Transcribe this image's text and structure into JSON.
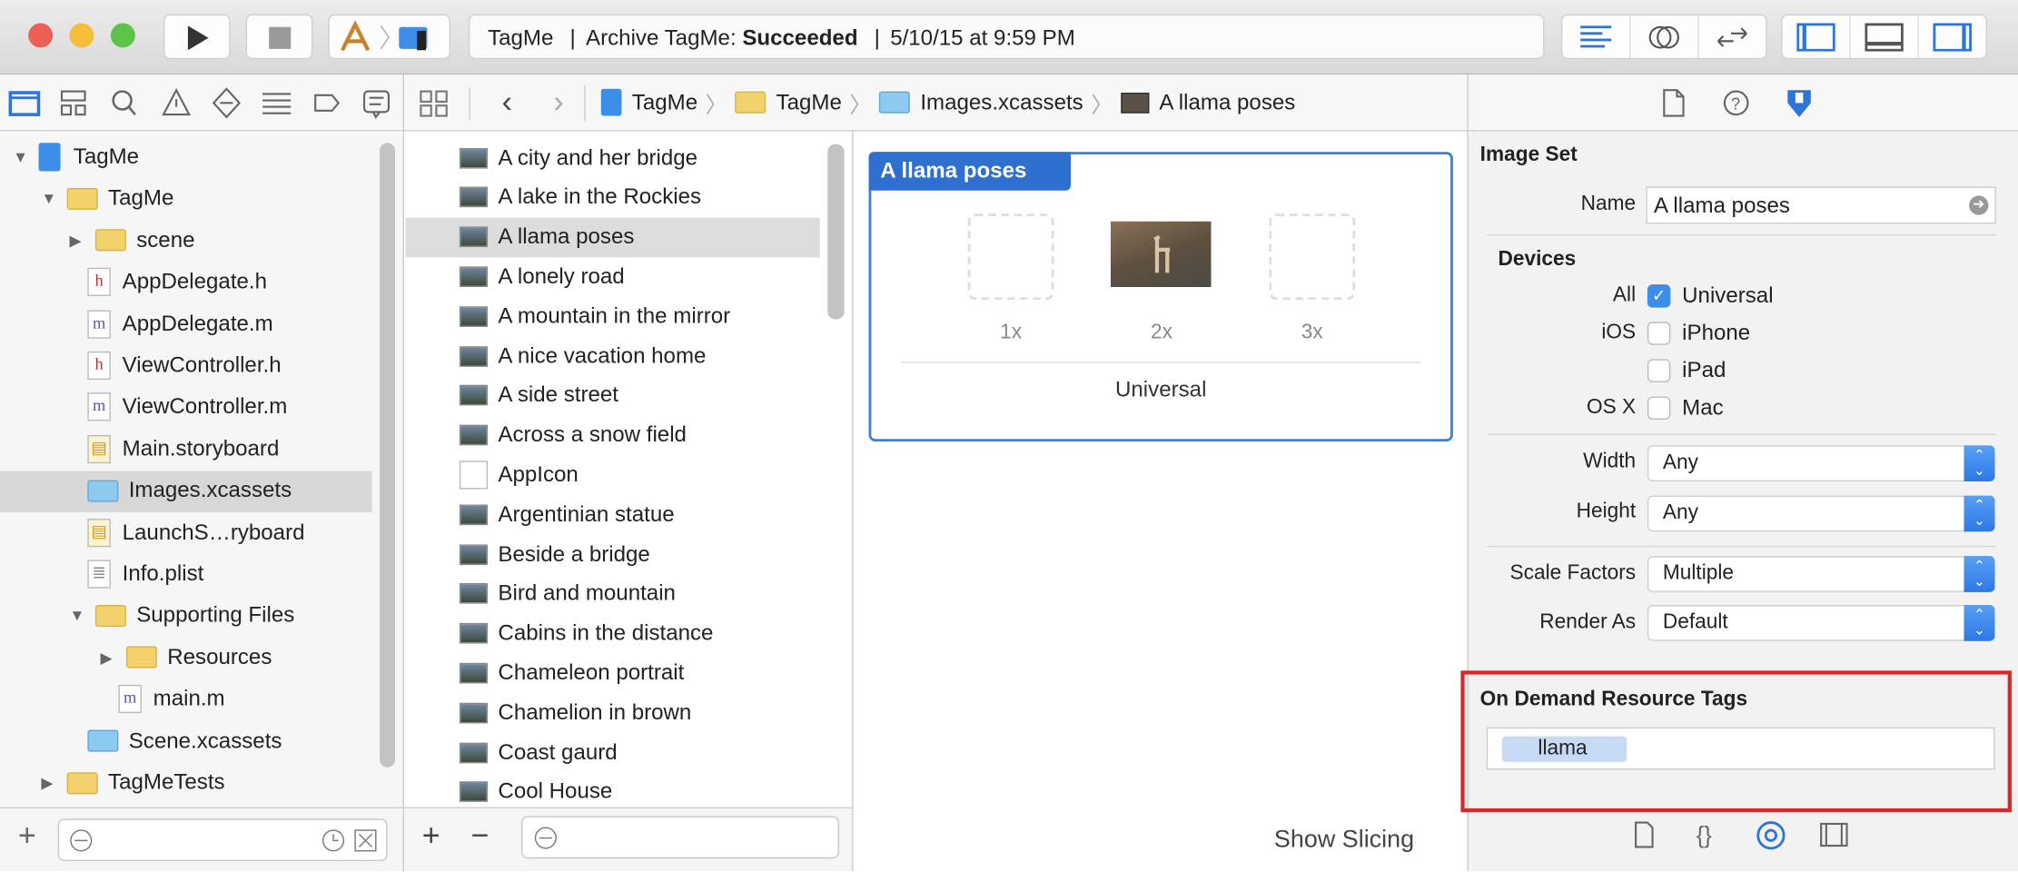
{
  "toolbar": {
    "scheme_app": "TagMe",
    "activity_project": "TagMe",
    "activity_action": "Archive TagMe: ",
    "activity_status": "Succeeded",
    "activity_time": "5/10/15 at 9:59 PM",
    "separator": "|"
  },
  "jumpbar": {
    "items": [
      "TagMe",
      "TagMe",
      "Images.xcassets",
      "A llama poses"
    ]
  },
  "navigator": {
    "items": [
      {
        "label": "TagMe",
        "type": "project",
        "level": 0,
        "expanded": true
      },
      {
        "label": "TagMe",
        "type": "folder",
        "level": 1,
        "expanded": true
      },
      {
        "label": "scene",
        "type": "folder",
        "level": 2,
        "expanded": false
      },
      {
        "label": "AppDelegate.h",
        "type": "h",
        "level": 2
      },
      {
        "label": "AppDelegate.m",
        "type": "m",
        "level": 2
      },
      {
        "label": "ViewController.h",
        "type": "h",
        "level": 2
      },
      {
        "label": "ViewController.m",
        "type": "m",
        "level": 2
      },
      {
        "label": "Main.storyboard",
        "type": "storyboard",
        "level": 2
      },
      {
        "label": "Images.xcassets",
        "type": "xcassets",
        "level": 2,
        "selected": true
      },
      {
        "label": "LaunchS…ryboard",
        "type": "storyboard",
        "level": 2
      },
      {
        "label": "Info.plist",
        "type": "plist",
        "level": 2
      },
      {
        "label": "Supporting Files",
        "type": "folder",
        "level": 2,
        "expanded": true
      },
      {
        "label": "Resources",
        "type": "folder",
        "level": 3,
        "expanded": false
      },
      {
        "label": "main.m",
        "type": "m",
        "level": 3
      },
      {
        "label": "Scene.xcassets",
        "type": "xcassets",
        "level": 2
      },
      {
        "label": "TagMeTests",
        "type": "folder",
        "level": 1,
        "expanded": false
      }
    ]
  },
  "assets": {
    "items": [
      "A city and her bridge",
      "A lake in the Rockies",
      "A llama poses",
      "A lonely road",
      "A mountain in the mirror",
      "A nice vacation home",
      "A side street",
      "Across a snow field",
      "AppIcon",
      "Argentinian statue",
      "Beside a bridge",
      "Bird and mountain",
      "Cabins in the distance",
      "Chameleon portrait",
      "Chamelion in brown",
      "Coast gaurd",
      "Cool House"
    ],
    "selected": "A llama poses"
  },
  "editor": {
    "set_title": "A llama poses",
    "slots": [
      "1x",
      "2x",
      "3x"
    ],
    "group_label": "Universal",
    "show_slicing": "Show Slicing"
  },
  "inspector": {
    "section_title": "Image Set",
    "name_label": "Name",
    "name_value": "A llama poses",
    "devices_title": "Devices",
    "devices": [
      {
        "group": "All",
        "label": "Universal",
        "checked": true
      },
      {
        "group": "iOS",
        "label": "iPhone",
        "checked": false
      },
      {
        "group": "",
        "label": "iPad",
        "checked": false
      },
      {
        "group": "OS X",
        "label": "Mac",
        "checked": false
      }
    ],
    "width_label": "Width",
    "width_value": "Any",
    "height_label": "Height",
    "height_value": "Any",
    "scale_label": "Scale Factors",
    "scale_value": "Multiple",
    "render_label": "Render As",
    "render_value": "Default",
    "odr_title": "On Demand Resource Tags",
    "tags": [
      "llama"
    ]
  },
  "colors": {
    "accent": "#2f74d9",
    "selection": "#d7d7d7",
    "highlight_box": "#d32a2a",
    "tag_token": "#c6dbf3"
  },
  "symbols": {
    "plus": "+",
    "minus": "−"
  }
}
